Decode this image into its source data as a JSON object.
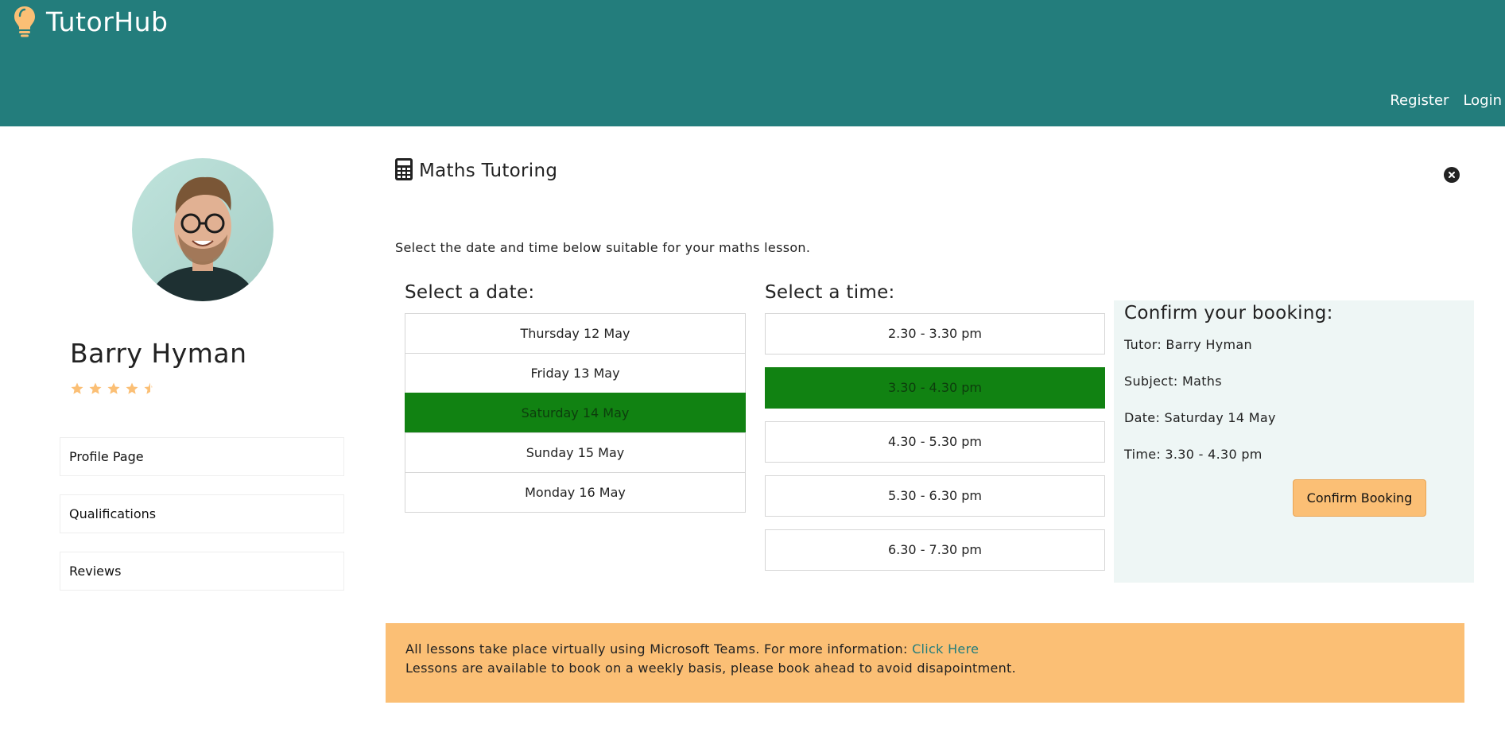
{
  "app": {
    "brand": "TutorHub",
    "accent_color": "#237d7c",
    "logo_icon": "lightbulb-icon"
  },
  "nav": {
    "register": "Register",
    "login": "Login"
  },
  "tutor": {
    "name": "Barry Hyman",
    "rating": 4.5,
    "rating_max": 5,
    "star_color": "#fbbf75"
  },
  "sidebar": {
    "items": [
      {
        "label": "Profile Page"
      },
      {
        "label": "Qualifications"
      },
      {
        "label": "Reviews"
      }
    ]
  },
  "main": {
    "title": "Maths Tutoring",
    "title_icon": "calculator-icon",
    "close_icon": "close-icon",
    "intro": "Select the date and time below suitable for your maths lesson."
  },
  "dates": {
    "heading": "Select a date:",
    "options": [
      "Thursday 12 May",
      "Friday 13 May",
      "Saturday 14 May",
      "Sunday 15 May",
      "Monday 16 May"
    ],
    "selected": "Saturday 14 May"
  },
  "times": {
    "heading": "Select a time:",
    "options": [
      "2.30 - 3.30 pm",
      "3.30 - 4.30 pm",
      "4.30 - 5.30 pm",
      "5.30 - 6.30 pm",
      "6.30 - 7.30 pm"
    ],
    "selected": "3.30 - 4.30 pm"
  },
  "selected_color": "#118212",
  "confirm": {
    "heading": "Confirm your booking:",
    "tutor": "Tutor: Barry Hyman",
    "subject": "Subject: Maths",
    "date": "Date: Saturday 14 May",
    "time": "Time: 3.30 - 4.30 pm",
    "button": "Confirm Booking"
  },
  "notice": {
    "line1": "All lessons take place virtually using Microsoft Teams. For more information:",
    "link": "Click Here",
    "line2": "Lessons are available to book on a weekly basis, please book ahead to avoid disapointment."
  }
}
